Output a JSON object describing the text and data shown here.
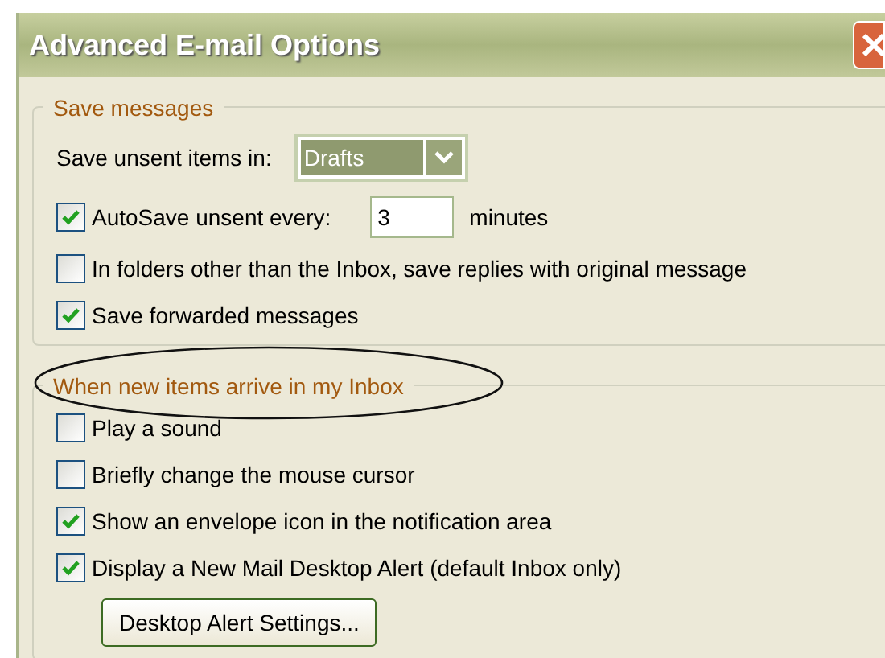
{
  "window": {
    "title": "Advanced E-mail Options"
  },
  "groups": [
    {
      "legend": "Save messages",
      "circled": false,
      "rows": [
        {
          "kind": "dropdown",
          "label": "Save unsent items in:",
          "value": "Drafts"
        },
        {
          "kind": "checkbox-number",
          "label": "AutoSave unsent every:",
          "checked": true,
          "value": "3",
          "unit": "minutes"
        },
        {
          "kind": "checkbox",
          "label": "In folders other than the Inbox, save replies with original message",
          "checked": false
        },
        {
          "kind": "checkbox",
          "label": "Save forwarded messages",
          "checked": true
        }
      ]
    },
    {
      "legend": "When new items arrive in my Inbox",
      "circled": true,
      "rows": [
        {
          "kind": "checkbox",
          "label": "Play a sound",
          "checked": false
        },
        {
          "kind": "checkbox",
          "label": "Briefly change the mouse cursor",
          "checked": false
        },
        {
          "kind": "checkbox",
          "label": "Show an envelope icon in the notification area",
          "checked": true
        },
        {
          "kind": "checkbox",
          "label": "Display a New Mail Desktop Alert (default Inbox only)",
          "checked": true
        },
        {
          "kind": "button",
          "label": "Desktop Alert Settings..."
        }
      ]
    }
  ]
}
